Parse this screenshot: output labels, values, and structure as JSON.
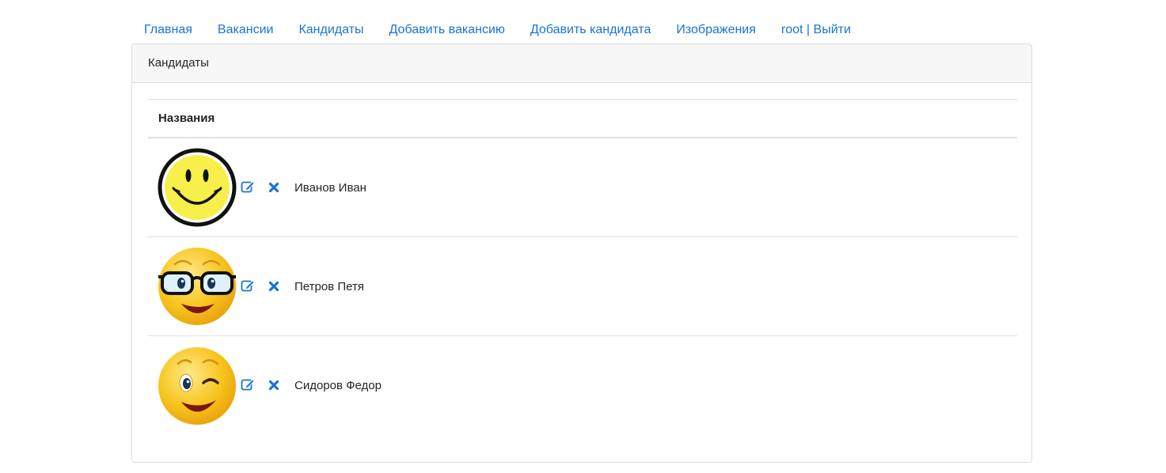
{
  "nav": {
    "items": [
      {
        "label": "Главная"
      },
      {
        "label": "Вакансии"
      },
      {
        "label": "Кандидаты"
      },
      {
        "label": "Добавить вакансию"
      },
      {
        "label": "Добавить кандидата"
      },
      {
        "label": "Изображения"
      },
      {
        "label": "root | Выйти"
      }
    ]
  },
  "card": {
    "header": "Кандидаты",
    "table": {
      "column_header": "Названия",
      "rows": [
        {
          "name": "Иванов Иван",
          "avatar": "classic-smiley-icon"
        },
        {
          "name": "Петров Петя",
          "avatar": "glasses-emoji-icon"
        },
        {
          "name": "Сидоров Федор",
          "avatar": "winking-emoji-icon"
        }
      ]
    }
  },
  "colors": {
    "link": "#1a73d9",
    "action_icon": "#1a73d9",
    "header_bg": "#f7f7f7",
    "emoji_yellow": "#f7c51e",
    "smiley_yellow": "#f7ef4a"
  },
  "icons": {
    "edit": "edit-icon",
    "delete": "close-icon"
  }
}
